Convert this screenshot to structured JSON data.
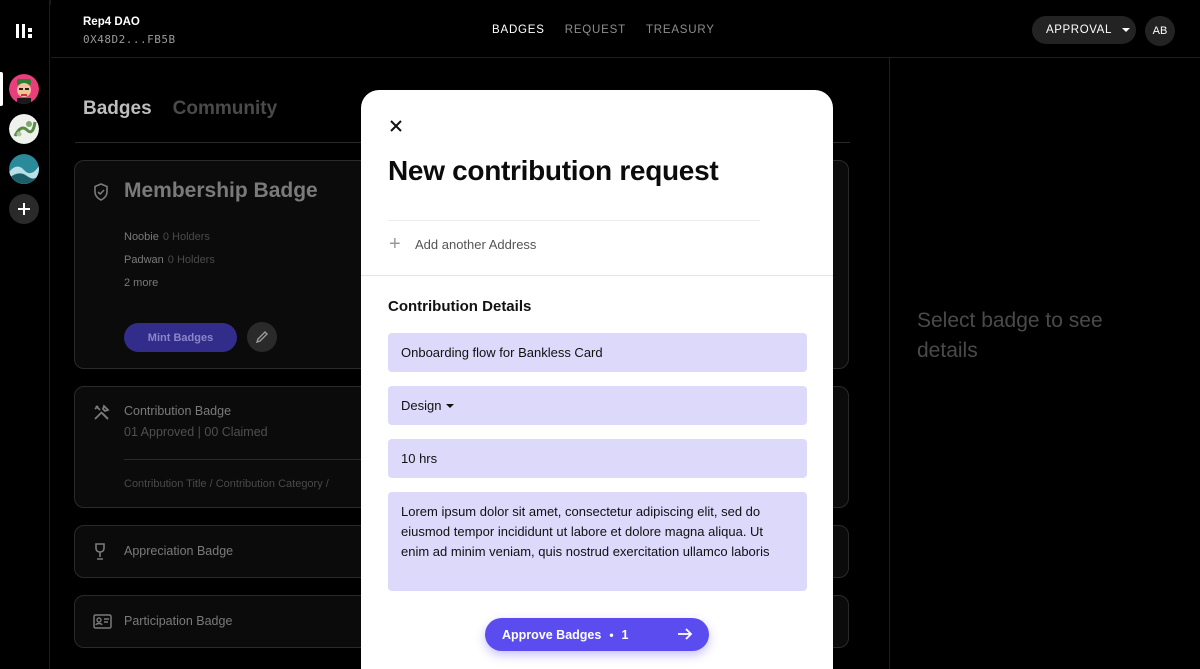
{
  "app": {
    "dao_name": "Rep4 DAO",
    "dao_address": "0X48D2...FB5B",
    "nav": [
      "BADGES",
      "REQUEST",
      "TREASURY"
    ],
    "nav_active": "BADGES",
    "approval_label": "APPROVAL",
    "avatar_initials": "AB"
  },
  "sidebar": {
    "daos": [
      "dao-avatar-1",
      "dao-avatar-2",
      "dao-avatar-3"
    ],
    "add_icon": "plus-icon"
  },
  "main": {
    "tabs": [
      "Badges",
      "Community"
    ],
    "membership": {
      "title": "Membership Badge",
      "levels": [
        {
          "name": "Noobie",
          "holders": "0 Holders"
        },
        {
          "name": "Padwan",
          "holders": "0 Holders"
        }
      ],
      "more": "2 more",
      "mint_label": "Mint Badges"
    },
    "contribution": {
      "title": "Contribution Badge",
      "stats": "01 Approved | 00 Claimed",
      "meta": "Contribution Title / Contribution Category /"
    },
    "appreciation": {
      "title": "Appreciation Badge"
    },
    "participation": {
      "title": "Participation Badge"
    }
  },
  "right_panel": {
    "hint": "Select badge to see details"
  },
  "modal": {
    "title": "New contribution request",
    "add_address_label": "Add another Address",
    "section_title": "Contribution Details",
    "title_field": "Onboarding flow for Bankless Card",
    "category": "Design",
    "time_spent": "10 hrs",
    "description": "Lorem ipsum dolor sit amet, consectetur adipiscing elit, sed do eiusmod tempor incididunt ut labore et dolore magna aliqua. Ut enim ad minim veniam, quis nostrud exercitation ullamco laboris",
    "approve_label": "Approve Badges",
    "approve_count": "1"
  },
  "colors": {
    "accent": "#5b4cf0",
    "field_bg": "#ddd9fb",
    "background": "#000000"
  }
}
